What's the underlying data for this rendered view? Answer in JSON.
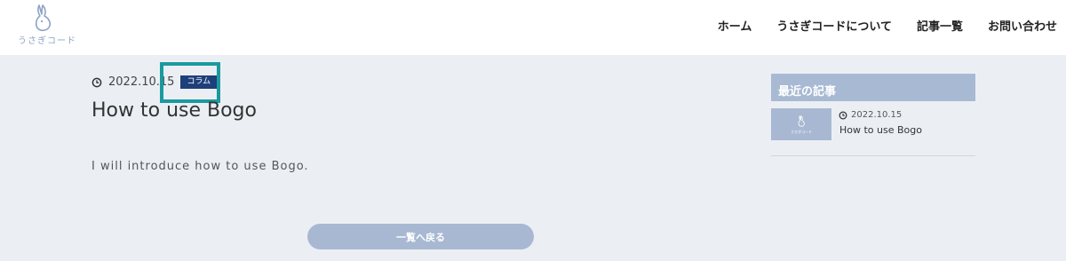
{
  "header": {
    "logo_text": "うさぎコード",
    "nav": [
      "ホーム",
      "うさぎコードについて",
      "記事一覧",
      "お問い合わせ"
    ]
  },
  "post": {
    "date": "2022.10.15",
    "category": "コラム",
    "title": "How to use Bogo",
    "body": "I will introduce how to use Bogo."
  },
  "back_button_label": "一覧へ戻る",
  "sidebar": {
    "heading": "最近の記事",
    "items": [
      {
        "date": "2022.10.15",
        "title": "How to use Bogo",
        "thumb_text": "うさぎコード"
      }
    ]
  },
  "colors": {
    "brand": "#8ea3c3",
    "badge": "#1e3f7a",
    "highlight": "#1a9aa0",
    "background": "#ebeff4"
  }
}
